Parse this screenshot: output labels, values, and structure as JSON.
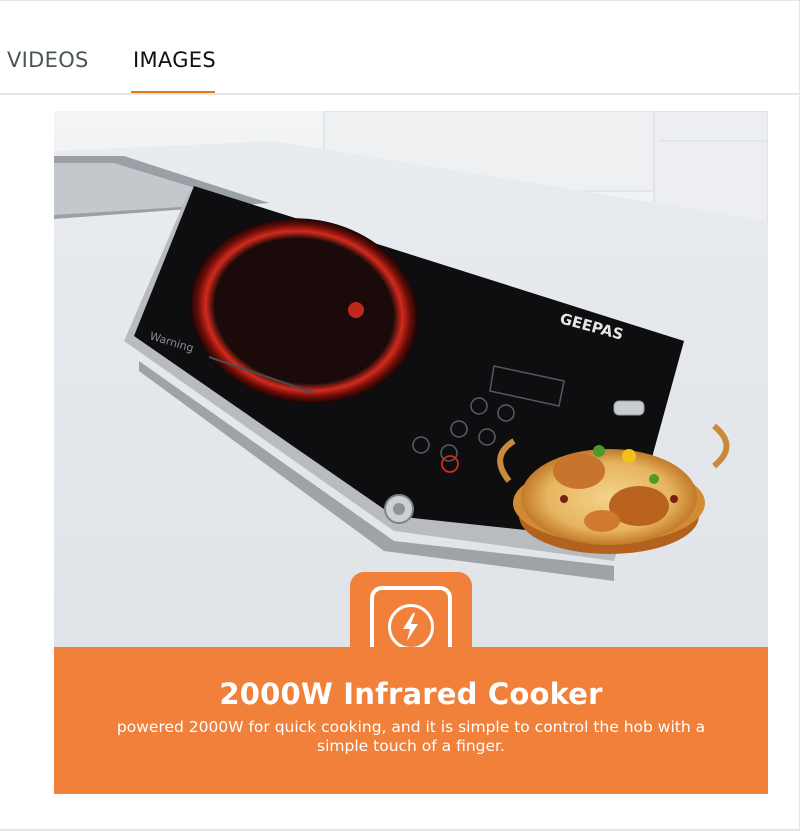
{
  "tabs": {
    "items": [
      {
        "label": "VIDEOS",
        "selected": false
      },
      {
        "label": "IMAGES",
        "selected": true
      }
    ],
    "accent_color": "#e47911"
  },
  "product_image": {
    "brand_logo": "GEEPAS",
    "cooktop_warning_text": "Warning",
    "headline": "2000W Infrared Cooker",
    "description": "powered 2000W for quick cooking, and it is simple to control the hob with a simple touch of a finger.",
    "badge_icon": "lightning-bolt-icon",
    "banner_color": "#f0803a"
  }
}
